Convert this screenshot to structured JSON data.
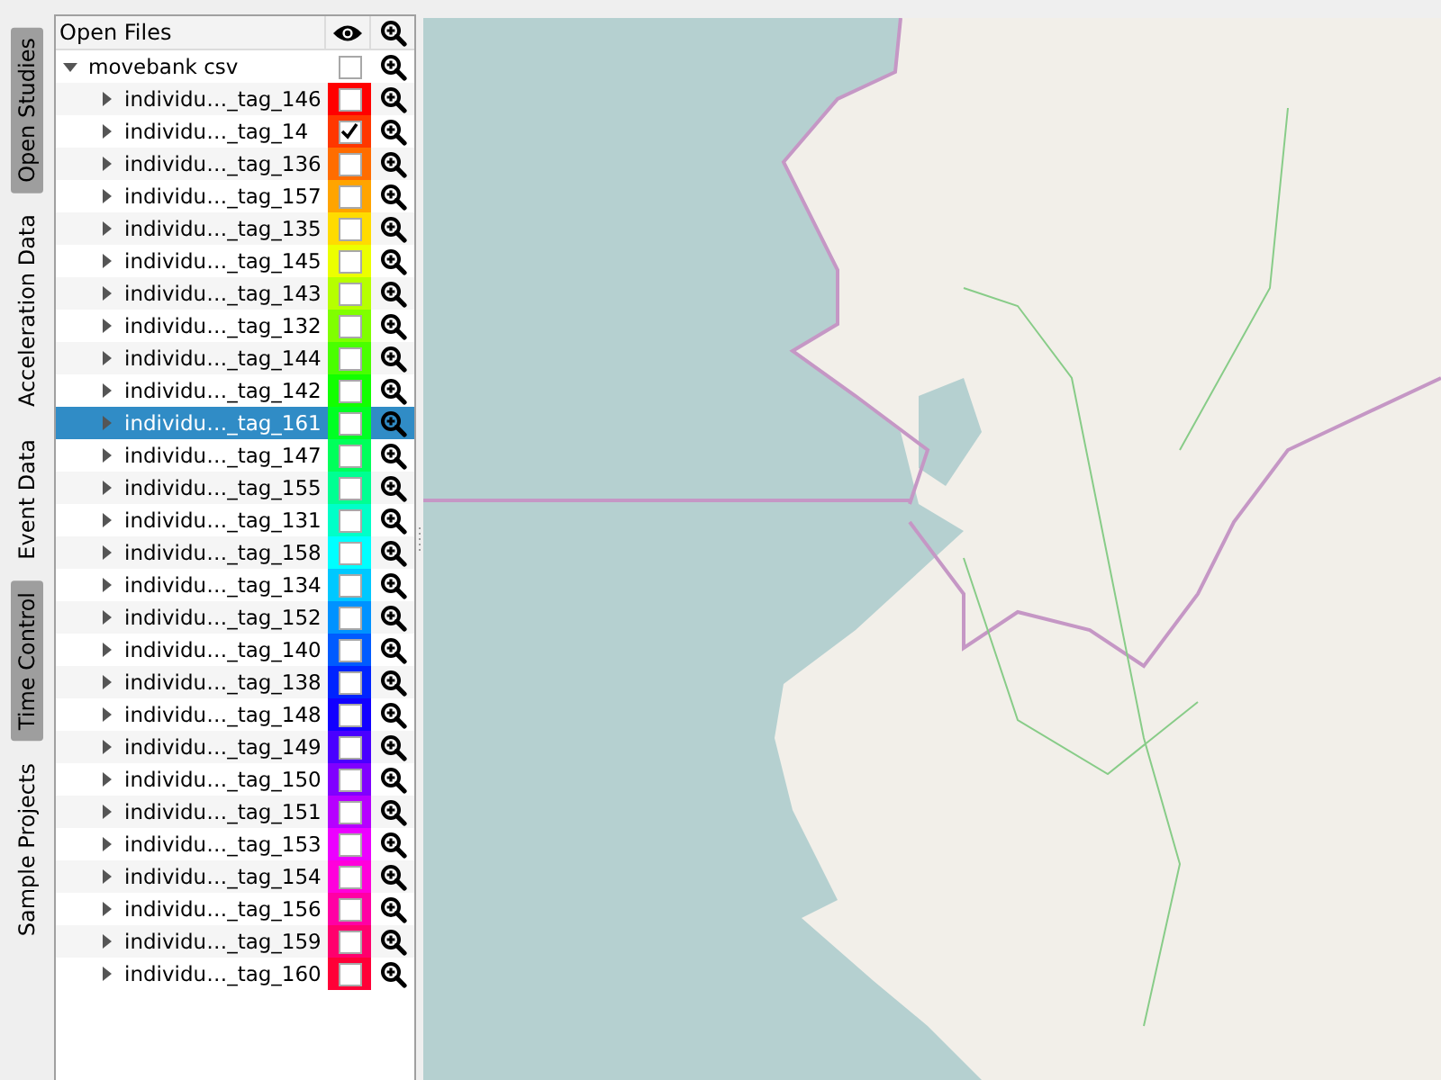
{
  "side_tabs": [
    {
      "label": "Open Studies",
      "selected": true
    },
    {
      "label": "Acceleration Data",
      "selected": false
    },
    {
      "label": "Event Data",
      "selected": false
    },
    {
      "label": "Time Control",
      "selected": true
    },
    {
      "label": "Sample Projects",
      "selected": false
    }
  ],
  "panel": {
    "title": "Open Files",
    "tree": [
      {
        "name": "movebank csv",
        "expanded": true,
        "checked": false,
        "selected": false,
        "children": [
          {
            "name": "individu…_tag_146",
            "expanded": false,
            "checked": false,
            "selected": false,
            "color": "#ff0000"
          },
          {
            "name": "individu…_tag_14",
            "expanded": false,
            "checked": true,
            "selected": false,
            "color": "#ff3700"
          },
          {
            "name": "individu…_tag_136",
            "expanded": false,
            "checked": false,
            "selected": false,
            "color": "#ff6d00"
          },
          {
            "name": "individu…_tag_157",
            "expanded": false,
            "checked": false,
            "selected": false,
            "color": "#ffa400"
          },
          {
            "name": "individu…_tag_135",
            "expanded": false,
            "checked": false,
            "selected": false,
            "color": "#ffdb00"
          },
          {
            "name": "individu…_tag_145",
            "expanded": false,
            "checked": false,
            "selected": false,
            "color": "#ecff00"
          },
          {
            "name": "individu…_tag_143",
            "expanded": false,
            "checked": false,
            "selected": false,
            "color": "#b6ff00"
          },
          {
            "name": "individu…_tag_132",
            "expanded": false,
            "checked": false,
            "selected": false,
            "color": "#80ff00"
          },
          {
            "name": "individu…_tag_144",
            "expanded": false,
            "checked": false,
            "selected": false,
            "color": "#49ff00"
          },
          {
            "name": "individu…_tag_142",
            "expanded": false,
            "checked": false,
            "selected": false,
            "color": "#12ff00"
          },
          {
            "name": "individu…_tag_161",
            "expanded": false,
            "checked": false,
            "selected": true,
            "color": "#00ff24"
          },
          {
            "name": "individu…_tag_147",
            "expanded": false,
            "checked": false,
            "selected": false,
            "color": "#00ff5b"
          },
          {
            "name": "individu…_tag_155",
            "expanded": false,
            "checked": false,
            "selected": false,
            "color": "#00ff92"
          },
          {
            "name": "individu…_tag_131",
            "expanded": false,
            "checked": false,
            "selected": false,
            "color": "#00ffc8"
          },
          {
            "name": "individu…_tag_158",
            "expanded": false,
            "checked": false,
            "selected": false,
            "color": "#00ffff"
          },
          {
            "name": "individu…_tag_134",
            "expanded": false,
            "checked": false,
            "selected": false,
            "color": "#00c8ff"
          },
          {
            "name": "individu…_tag_152",
            "expanded": false,
            "checked": false,
            "selected": false,
            "color": "#0092ff"
          },
          {
            "name": "individu…_tag_140",
            "expanded": false,
            "checked": false,
            "selected": false,
            "color": "#005bff"
          },
          {
            "name": "individu…_tag_138",
            "expanded": false,
            "checked": false,
            "selected": false,
            "color": "#0024ff"
          },
          {
            "name": "individu…_tag_148",
            "expanded": false,
            "checked": false,
            "selected": false,
            "color": "#1200ff"
          },
          {
            "name": "individu…_tag_149",
            "expanded": false,
            "checked": false,
            "selected": false,
            "color": "#4900ff"
          },
          {
            "name": "individu…_tag_150",
            "expanded": false,
            "checked": false,
            "selected": false,
            "color": "#8000ff"
          },
          {
            "name": "individu…_tag_151",
            "expanded": false,
            "checked": false,
            "selected": false,
            "color": "#b600ff"
          },
          {
            "name": "individu…_tag_153",
            "expanded": false,
            "checked": false,
            "selected": false,
            "color": "#ec00ff"
          },
          {
            "name": "individu…_tag_154",
            "expanded": false,
            "checked": false,
            "selected": false,
            "color": "#ff00db"
          },
          {
            "name": "individu…_tag_156",
            "expanded": false,
            "checked": false,
            "selected": false,
            "color": "#ff00a4"
          },
          {
            "name": "individu…_tag_159",
            "expanded": false,
            "checked": false,
            "selected": false,
            "color": "#ff006d"
          },
          {
            "name": "individu…_tag_160",
            "expanded": false,
            "checked": false,
            "selected": false,
            "color": "#ff0037"
          }
        ]
      }
    ]
  }
}
